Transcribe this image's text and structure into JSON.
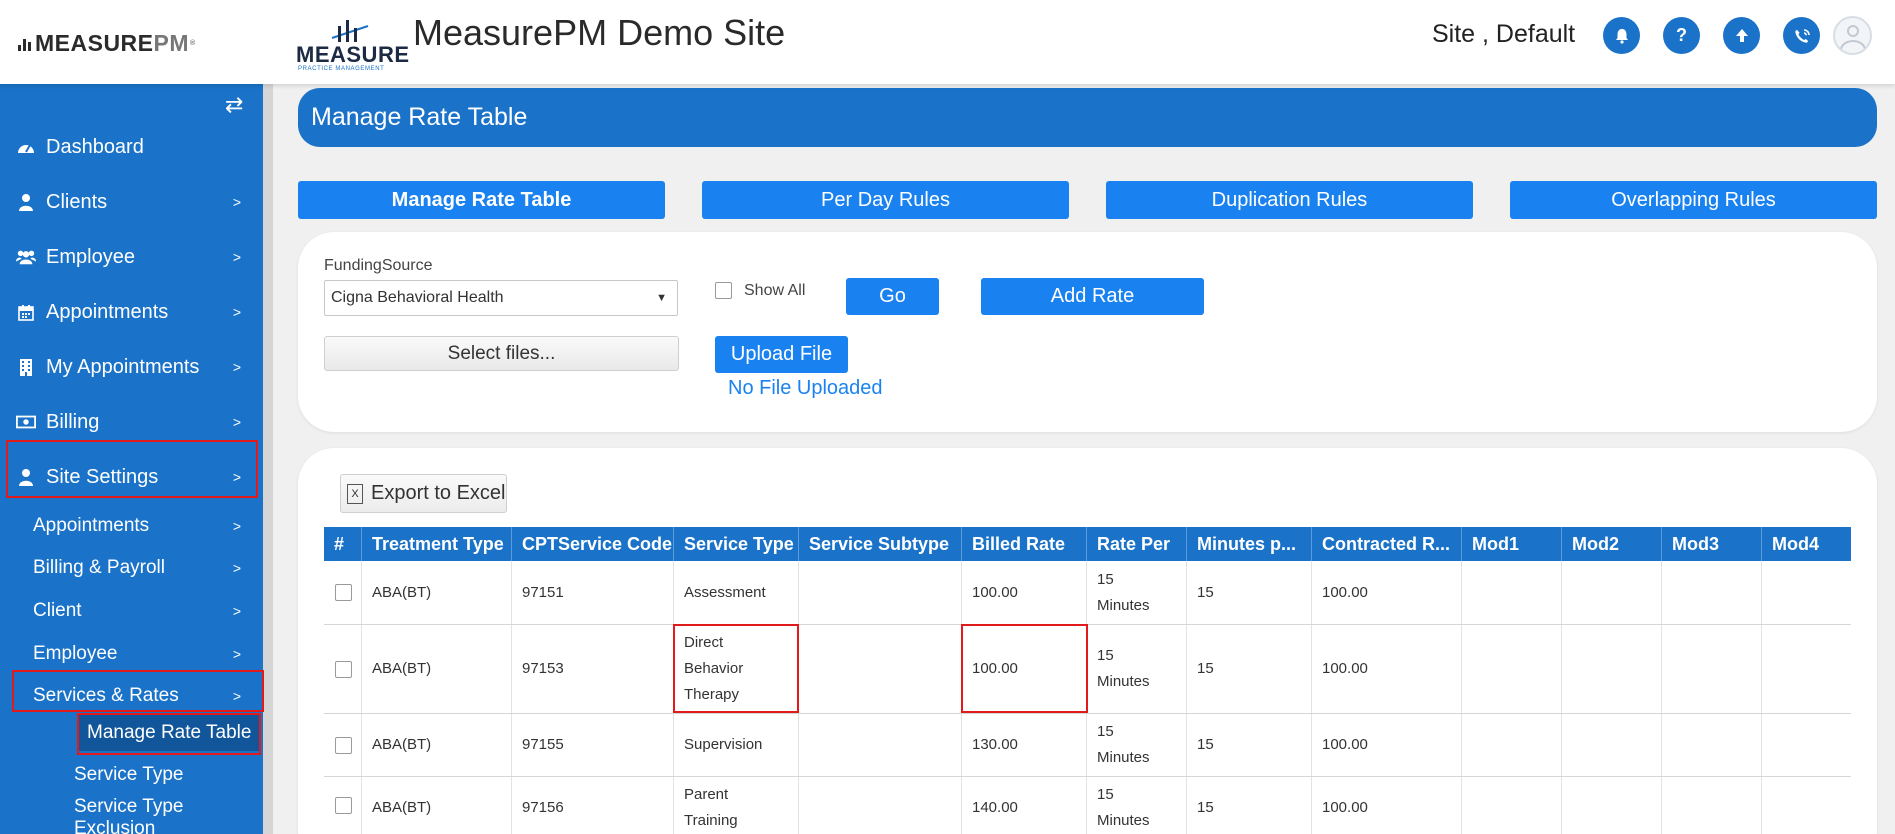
{
  "header": {
    "brand_main": "MEASURE",
    "brand_pm": "PM",
    "brand_tm": "®",
    "logo_word": "MEASURE",
    "logo_sub": "PRACTICE MANAGEMENT",
    "site_title": "MeasurePM Demo Site",
    "user_name": "Site , Default",
    "icons": [
      "bell-icon",
      "help-icon",
      "upload-icon",
      "phone-icon",
      "user-avatar"
    ]
  },
  "sidebar": {
    "items": [
      {
        "label": "Dashboard",
        "icon": "dashboard-icon"
      },
      {
        "label": "Clients",
        "icon": "user-icon"
      },
      {
        "label": "Employee",
        "icon": "users-icon"
      },
      {
        "label": "Appointments",
        "icon": "calendar-icon"
      },
      {
        "label": "My Appointments",
        "icon": "building-icon"
      },
      {
        "label": "Billing",
        "icon": "money-icon"
      },
      {
        "label": "Site Settings",
        "icon": "user-icon"
      }
    ],
    "sub_items": [
      "Appointments",
      "Billing & Payroll",
      "Client",
      "Employee",
      "Services & Rates"
    ],
    "subsub_items": [
      "Manage Rate Table",
      "Service Type",
      "Service Type Exclusion"
    ]
  },
  "main": {
    "banner_title": "Manage Rate Table",
    "tabs": [
      "Manage Rate Table",
      "Per Day Rules",
      "Duplication Rules",
      "Overlapping Rules"
    ],
    "funding_label": "FundingSource",
    "funding_value": "Cigna Behavioral Health",
    "show_all_label": "Show All",
    "go_label": "Go",
    "add_rate_label": "Add Rate",
    "select_files_label": "Select files...",
    "upload_label": "Upload File",
    "no_file_text": "No File Uploaded",
    "export_label": "Export to Excel",
    "export_icon": "excel-icon"
  },
  "table": {
    "columns": [
      "#",
      "Treatment Type",
      "CPTService Code",
      "Service Type",
      "Service Subtype",
      "Billed Rate",
      "Rate Per",
      "Minutes p...",
      "Contracted R...",
      "Mod1",
      "Mod2",
      "Mod3",
      "Mod4"
    ],
    "rows": [
      {
        "treatment": "ABA(BT)",
        "code": "97151",
        "service": [
          "Assessment"
        ],
        "subtype": "",
        "billed": "100.00",
        "rate_per": [
          "15",
          "Minutes"
        ],
        "minutes": "15",
        "contracted": "100.00"
      },
      {
        "treatment": "ABA(BT)",
        "code": "97153",
        "service": [
          "Direct",
          "Behavior",
          "Therapy"
        ],
        "subtype": "",
        "billed": "100.00",
        "rate_per": [
          "15",
          "Minutes"
        ],
        "minutes": "15",
        "contracted": "100.00"
      },
      {
        "treatment": "ABA(BT)",
        "code": "97155",
        "service": [
          "Supervision"
        ],
        "subtype": "",
        "billed": "130.00",
        "rate_per": [
          "15",
          "Minutes"
        ],
        "minutes": "15",
        "contracted": "100.00"
      },
      {
        "treatment": "ABA(BT)",
        "code": "97156",
        "service": [
          "Parent",
          "Training"
        ],
        "subtype": "",
        "billed": "140.00",
        "rate_per": [
          "15",
          "Minutes"
        ],
        "minutes": "15",
        "contracted": "100.00"
      }
    ]
  }
}
